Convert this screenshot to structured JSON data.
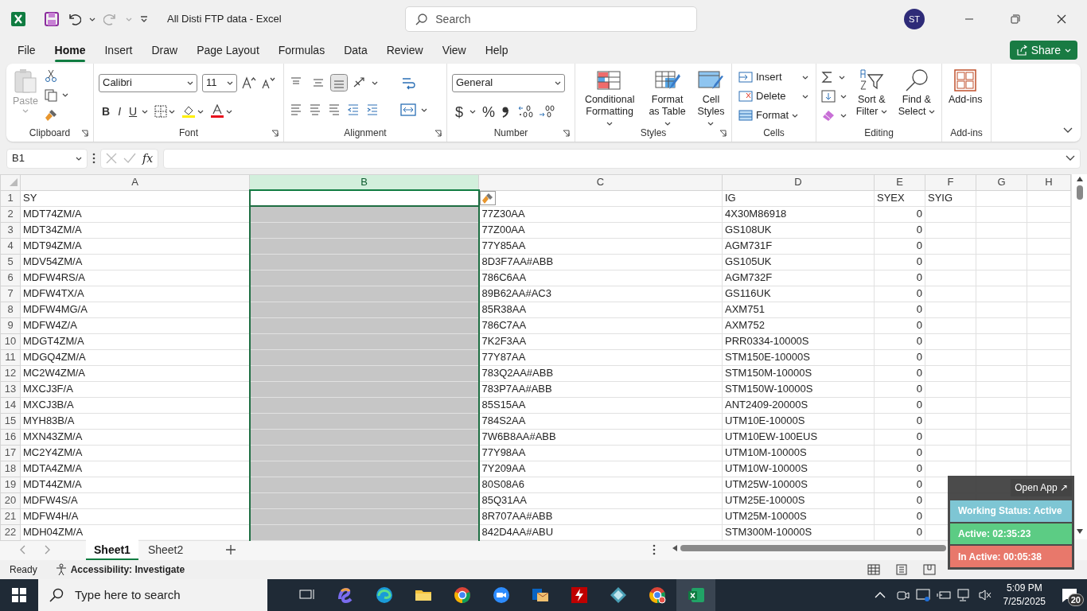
{
  "title_bar": {
    "document_title": "All Disti FTP data  -  Excel",
    "search_placeholder": "Search",
    "avatar_initials": "ST"
  },
  "menu_tabs": [
    {
      "label": "File",
      "selected": false
    },
    {
      "label": "Home",
      "selected": true
    },
    {
      "label": "Insert",
      "selected": false
    },
    {
      "label": "Draw",
      "selected": false
    },
    {
      "label": "Page Layout",
      "selected": false
    },
    {
      "label": "Formulas",
      "selected": false
    },
    {
      "label": "Data",
      "selected": false
    },
    {
      "label": "Review",
      "selected": false
    },
    {
      "label": "View",
      "selected": false
    },
    {
      "label": "Help",
      "selected": false
    }
  ],
  "share_button": "Share",
  "ribbon": {
    "clipboard": {
      "label": "Clipboard",
      "paste": "Paste"
    },
    "font": {
      "label": "Font",
      "font_name": "Calibri",
      "font_size": "11",
      "style_buttons": [
        "B",
        "I",
        "U"
      ]
    },
    "alignment": {
      "label": "Alignment"
    },
    "number": {
      "label": "Number",
      "format": "General",
      "symbols": [
        "$",
        "%"
      ]
    },
    "styles": {
      "label": "Styles",
      "buttons": [
        "Conditional Formatting",
        "Format as Table",
        "Cell Styles"
      ]
    },
    "cells": {
      "label": "Cells",
      "buttons": [
        "Insert",
        "Delete",
        "Format"
      ]
    },
    "editing": {
      "label": "Editing",
      "buttons": [
        "Sort & Filter",
        "Find & Select"
      ]
    },
    "add_ins": {
      "label": "Add-ins",
      "button": "Add-ins"
    }
  },
  "formula_bar": {
    "name_box": "B1",
    "function_label": "fx"
  },
  "columns": [
    {
      "letter": "A",
      "selected": false,
      "kind": "text"
    },
    {
      "letter": "B",
      "selected": true,
      "kind": "text"
    },
    {
      "letter": "C",
      "selected": false,
      "kind": "text"
    },
    {
      "letter": "D",
      "selected": false,
      "kind": "text"
    },
    {
      "letter": "E",
      "selected": false,
      "kind": "number"
    },
    {
      "letter": "F",
      "selected": false,
      "kind": "text"
    },
    {
      "letter": "G",
      "selected": false,
      "kind": "text"
    },
    {
      "letter": "H",
      "selected": false,
      "kind": "text"
    }
  ],
  "header_row": {
    "number": "1",
    "cells": [
      "SY",
      null,
      null,
      "IG",
      "SYEX",
      "SYIG",
      null,
      null
    ]
  },
  "rows": [
    {
      "number": "2",
      "cells": [
        "MDT74ZM/A",
        null,
        "77Z30AA",
        "4X30M86918",
        "0"
      ]
    },
    {
      "number": "3",
      "cells": [
        "MDT34ZM/A",
        null,
        "77Z00AA",
        "GS108UK",
        "0"
      ]
    },
    {
      "number": "4",
      "cells": [
        "MDT94ZM/A",
        null,
        "77Y85AA",
        "AGM731F",
        "0"
      ]
    },
    {
      "number": "5",
      "cells": [
        "MDV54ZM/A",
        null,
        "8D3F7AA#ABB",
        "GS105UK",
        "0"
      ]
    },
    {
      "number": "6",
      "cells": [
        "MDFW4RS/A",
        null,
        "786C6AA",
        "AGM732F",
        "0"
      ]
    },
    {
      "number": "7",
      "cells": [
        "MDFW4TX/A",
        null,
        "89B62AA#AC3",
        "GS116UK",
        "0"
      ]
    },
    {
      "number": "8",
      "cells": [
        "MDFW4MG/A",
        null,
        "85R38AA",
        "AXM751",
        "0"
      ]
    },
    {
      "number": "9",
      "cells": [
        "MDFW4Z/A",
        null,
        "786C7AA",
        "AXM752",
        "0"
      ]
    },
    {
      "number": "10",
      "cells": [
        "MDGT4ZM/A",
        null,
        "7K2F3AA",
        "PRR0334-10000S",
        "0"
      ]
    },
    {
      "number": "11",
      "cells": [
        "MDGQ4ZM/A",
        null,
        "77Y87AA",
        "STM150E-10000S",
        "0"
      ]
    },
    {
      "number": "12",
      "cells": [
        "MC2W4ZM/A",
        null,
        "783Q2AA#ABB",
        "STM150M-10000S",
        "0"
      ]
    },
    {
      "number": "13",
      "cells": [
        "MXCJ3F/A",
        null,
        "783P7AA#ABB",
        "STM150W-10000S",
        "0"
      ]
    },
    {
      "number": "14",
      "cells": [
        "MXCJ3B/A",
        null,
        "85S15AA",
        "ANT2409-20000S",
        "0"
      ]
    },
    {
      "number": "15",
      "cells": [
        "MYH83B/A",
        null,
        "784S2AA",
        "UTM10E-10000S",
        "0"
      ]
    },
    {
      "number": "16",
      "cells": [
        "MXN43ZM/A",
        null,
        "7W6B8AA#ABB",
        "UTM10EW-100EUS",
        "0"
      ]
    },
    {
      "number": "17",
      "cells": [
        "MC2Y4ZM/A",
        null,
        "77Y98AA",
        "UTM10M-10000S",
        "0"
      ]
    },
    {
      "number": "18",
      "cells": [
        "MDTA4ZM/A",
        null,
        "7Y209AA",
        "UTM10W-10000S",
        "0"
      ]
    },
    {
      "number": "19",
      "cells": [
        "MDT44ZM/A",
        null,
        "80S08A6",
        "UTM25W-10000S",
        "0"
      ]
    },
    {
      "number": "20",
      "cells": [
        "MDFW4S/A",
        null,
        "85Q31AA",
        "UTM25E-10000S",
        "0"
      ]
    },
    {
      "number": "21",
      "cells": [
        "MDFW4H/A",
        null,
        "8R707AA#ABB",
        "UTM25M-10000S",
        "0"
      ]
    },
    {
      "number": "22",
      "cells": [
        "MDH04ZM/A",
        null,
        "842D4AA#ABU",
        "STM300M-10000S",
        "0"
      ]
    }
  ],
  "sheet_tabs": [
    {
      "label": "Sheet1",
      "selected": true
    },
    {
      "label": "Sheet2",
      "selected": false
    }
  ],
  "status_bar": {
    "mode": "Ready",
    "accessibility": "Accessibility: Investigate"
  },
  "tracker_widget": {
    "open_button": "Open App ↗",
    "items": [
      {
        "text": "Working Status: Active",
        "color": "#7ec6d4"
      },
      {
        "text": "Active: 02:35:23",
        "color": "#5ccc84"
      },
      {
        "text": "In Active: 00:05:38",
        "color": "#e8786b"
      }
    ]
  },
  "taskbar": {
    "search_placeholder": "Type here to search",
    "time": "5:09 PM",
    "date": "7/25/2025",
    "notifications": "20"
  }
}
